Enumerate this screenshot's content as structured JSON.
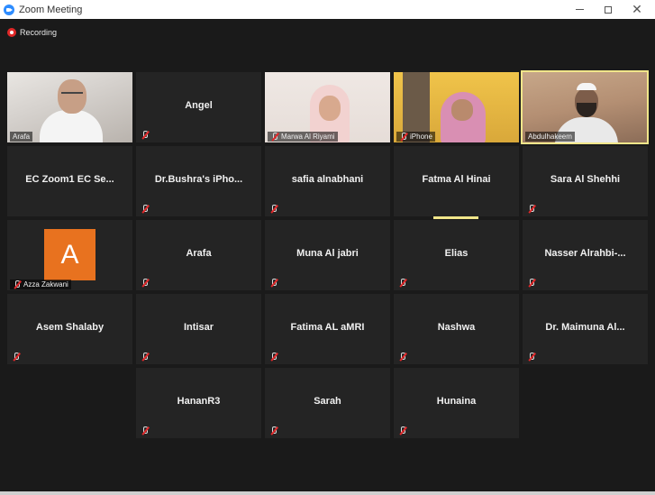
{
  "window": {
    "title": "Zoom Meeting",
    "minimize_icon": "minimize-icon",
    "maximize_icon": "maximize-icon",
    "close_icon": "close-icon",
    "close_glyph": "✕"
  },
  "recording": {
    "label": "Recording"
  },
  "colors": {
    "active_border": "#f1e68a",
    "tile_bg": "#242424",
    "avatar": "#e8721f",
    "recording": "#e02828"
  },
  "participants": {
    "arafa_video": "Arafa",
    "angel": "Angel",
    "marwa": "Marwa Al Riyami",
    "iphone": "iPhone",
    "abdulhakeem": "Abdulhakeem",
    "ec_zoom": "EC Zoom1 EC Se...",
    "bushra": "Dr.Bushra's iPho...",
    "safia": "safia alnabhani",
    "fatma": "Fatma Al Hinai",
    "sara": "Sara Al Shehhi",
    "azza": "Azza Zakwani",
    "azza_initial": "A",
    "arafa": "Arafa",
    "muna": "Muna Al jabri",
    "elias": "Elias",
    "nasser": "Nasser Alrahbi-...",
    "asem": "Asem Shalaby",
    "intisar": "Intisar",
    "fatima": "Fatima AL aMRI",
    "nashwa": "Nashwa",
    "maimuna": "Dr. Maimuna Al...",
    "hananr3": "HananR3",
    "sarah": "Sarah",
    "hunaina": "Hunaina"
  }
}
